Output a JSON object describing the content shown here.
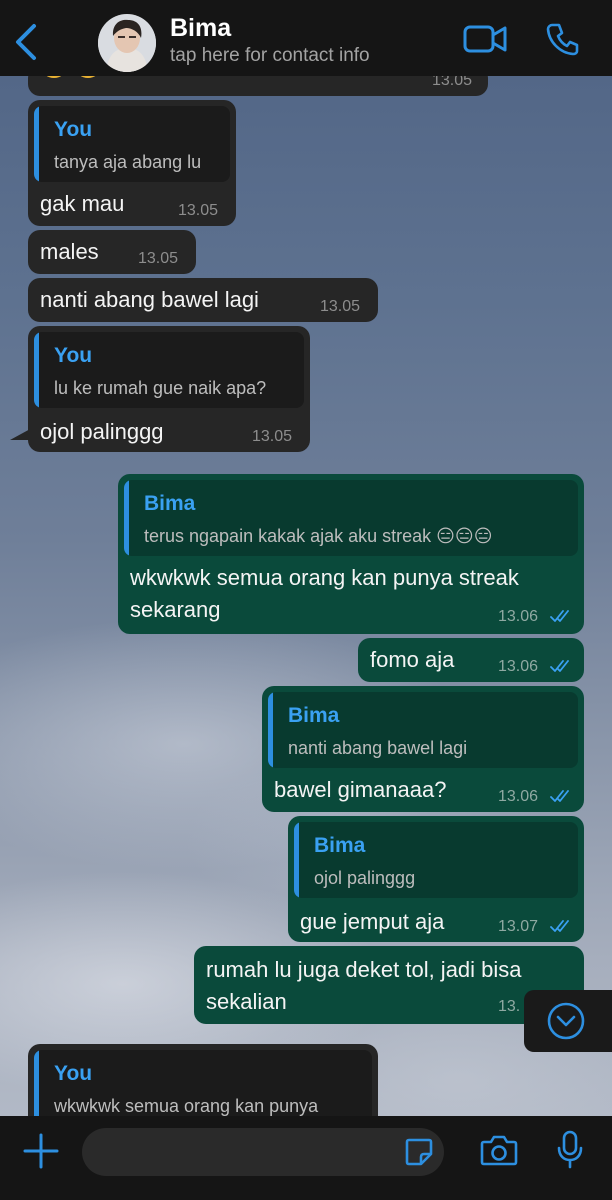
{
  "header": {
    "contact_name": "Bima",
    "subtitle": "tap here for contact info"
  },
  "colors": {
    "accent": "#2d8fe0",
    "incoming_bubble": "#262626",
    "outgoing_bubble": "#0a4a3b"
  },
  "messages": [
    {
      "time": "13.05"
    },
    {
      "quote_name": "You",
      "quote_text": "tanya aja abang lu",
      "text": "gak mau",
      "time": "13.05"
    },
    {
      "text": "males",
      "time": "13.05"
    },
    {
      "text": "nanti abang bawel lagi",
      "time": "13.05"
    },
    {
      "quote_name": "You",
      "quote_text": "lu ke rumah gue naik apa?",
      "text": "ojol palinggg",
      "time": "13.05"
    },
    {
      "quote_name": "Bima",
      "quote_text": "terus ngapain kakak ajak aku streak 😑😑😑",
      "text_line1": "wkwkwk semua orang kan punya streak",
      "text_line2": "sekarang",
      "time": "13.06"
    },
    {
      "text": "fomo aja",
      "time": "13.06"
    },
    {
      "quote_name": "Bima",
      "quote_text": "nanti abang bawel lagi",
      "text": "bawel gimanaaa?",
      "time": "13.06"
    },
    {
      "quote_name": "Bima",
      "quote_text": "ojol palinggg",
      "text": "gue jemput aja",
      "time": "13.07"
    },
    {
      "text_line1": "rumah lu juga deket tol, jadi bisa",
      "text_line2": "sekalian",
      "time": "13."
    },
    {
      "quote_name": "You",
      "quote_text": "wkwkwk semua orang kan punya"
    }
  ],
  "icons": {
    "back": "chevron-left-icon",
    "video": "video-call-icon",
    "call": "phone-icon",
    "scroll": "chevron-down-icon",
    "attach": "plus-icon",
    "sticker": "sticker-icon",
    "camera": "camera-icon",
    "mic": "microphone-icon"
  }
}
